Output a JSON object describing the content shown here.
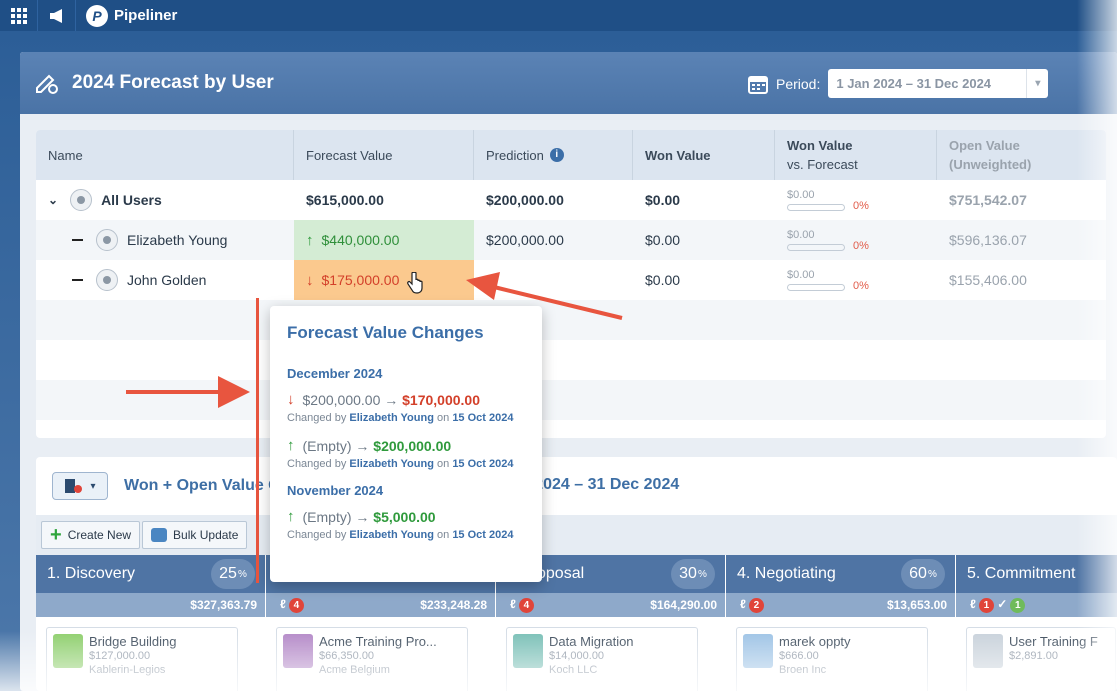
{
  "app": {
    "name": "Pipeliner"
  },
  "window": {
    "title": "2024 Forecast by User",
    "period_label": "Period:",
    "period_value": "1 Jan 2024 – 31 Dec 2024"
  },
  "table": {
    "columns": {
      "name": "Name",
      "forecast": "Forecast Value",
      "prediction": "Prediction",
      "won": "Won Value",
      "won_vs_1": "Won Value",
      "won_vs_2": "vs. Forecast",
      "open_1": "Open Value",
      "open_2": "(Unweighted)"
    },
    "rows": [
      {
        "name": "All Users",
        "forecast": "$615,000.00",
        "prediction": "$200,000.00",
        "won": "$0.00",
        "won_vs": "$0.00",
        "won_pct": "0%",
        "open": "$751,542.07"
      },
      {
        "name": "Elizabeth Young",
        "forecast": "$440,000.00",
        "prediction": "$200,000.00",
        "won": "$0.00",
        "won_vs": "$0.00",
        "won_pct": "0%",
        "open": "$596,136.07"
      },
      {
        "name": "John Golden",
        "forecast": "$175,000.00",
        "prediction": "",
        "won": "$0.00",
        "won_vs": "$0.00",
        "won_pct": "0%",
        "open": "$155,406.00"
      }
    ]
  },
  "popover": {
    "title": "Forecast Value Changes",
    "groups": [
      {
        "month": "December 2024",
        "changes": [
          {
            "from": "$200,000.00",
            "arrow": "→",
            "to": "$170,000.00",
            "by_prefix": "Changed by",
            "by": "Elizabeth Young",
            "on_prefix": "on",
            "date": "15 Oct 2024"
          },
          {
            "from": "(Empty)",
            "arrow": "→",
            "to": "$200,000.00",
            "by_prefix": "Changed by",
            "by": "Elizabeth Young",
            "on_prefix": "on",
            "date": "15 Oct 2024"
          }
        ]
      },
      {
        "month": "November 2024",
        "changes": [
          {
            "from": "(Empty)",
            "arrow": "→",
            "to": "$5,000.00",
            "by_prefix": "Changed by",
            "by": "Elizabeth Young",
            "on_prefix": "on",
            "date": "15 Oct 2024"
          }
        ]
      }
    ]
  },
  "lower": {
    "title": "Won + Open Value O",
    "title_right": "n 2024 – 31 Dec 2024",
    "toolbar": {
      "create": "Create New",
      "bulk": "Bulk Update"
    },
    "stages": [
      {
        "name": "1. Discovery",
        "pct": "25",
        "pct_sign": "%",
        "badge": "",
        "total": "$327,363.79",
        "card_title": "Bridge Building",
        "card_value": "$127,000.00",
        "card_account": "Kablerin-Legios"
      },
      {
        "name": "",
        "pct": "",
        "pct_sign": "",
        "badge": "4",
        "total": "$233,248.28",
        "card_title": "Acme Training Pro...",
        "card_value": "$66,350.00",
        "card_account": "Acme Belgium"
      },
      {
        "name": "oposal",
        "pct": "30",
        "pct_sign": "%",
        "badge": "4",
        "total": "$164,290.00",
        "card_title": "Data Migration",
        "card_value": "$14,000.00",
        "card_account": "Koch LLC"
      },
      {
        "name": "4. Negotiating",
        "pct": "60",
        "pct_sign": "%",
        "badge": "2",
        "total": "$13,653.00",
        "card_title": "marek oppty",
        "card_value": "$666.00",
        "card_account": "Broen Inc"
      },
      {
        "name": "5. Commitment",
        "pct": "",
        "pct_sign": "",
        "badge": "1",
        "badge2": "1",
        "total": "",
        "card_title": "User Training F",
        "card_value": "$2,891.00",
        "card_account": ""
      }
    ]
  },
  "colors": {
    "accent": "#3b6ea8",
    "header": "#4f74a4",
    "increase": "#2f9a3c",
    "decrease": "#d3402a",
    "annotation": "#e8553f"
  }
}
